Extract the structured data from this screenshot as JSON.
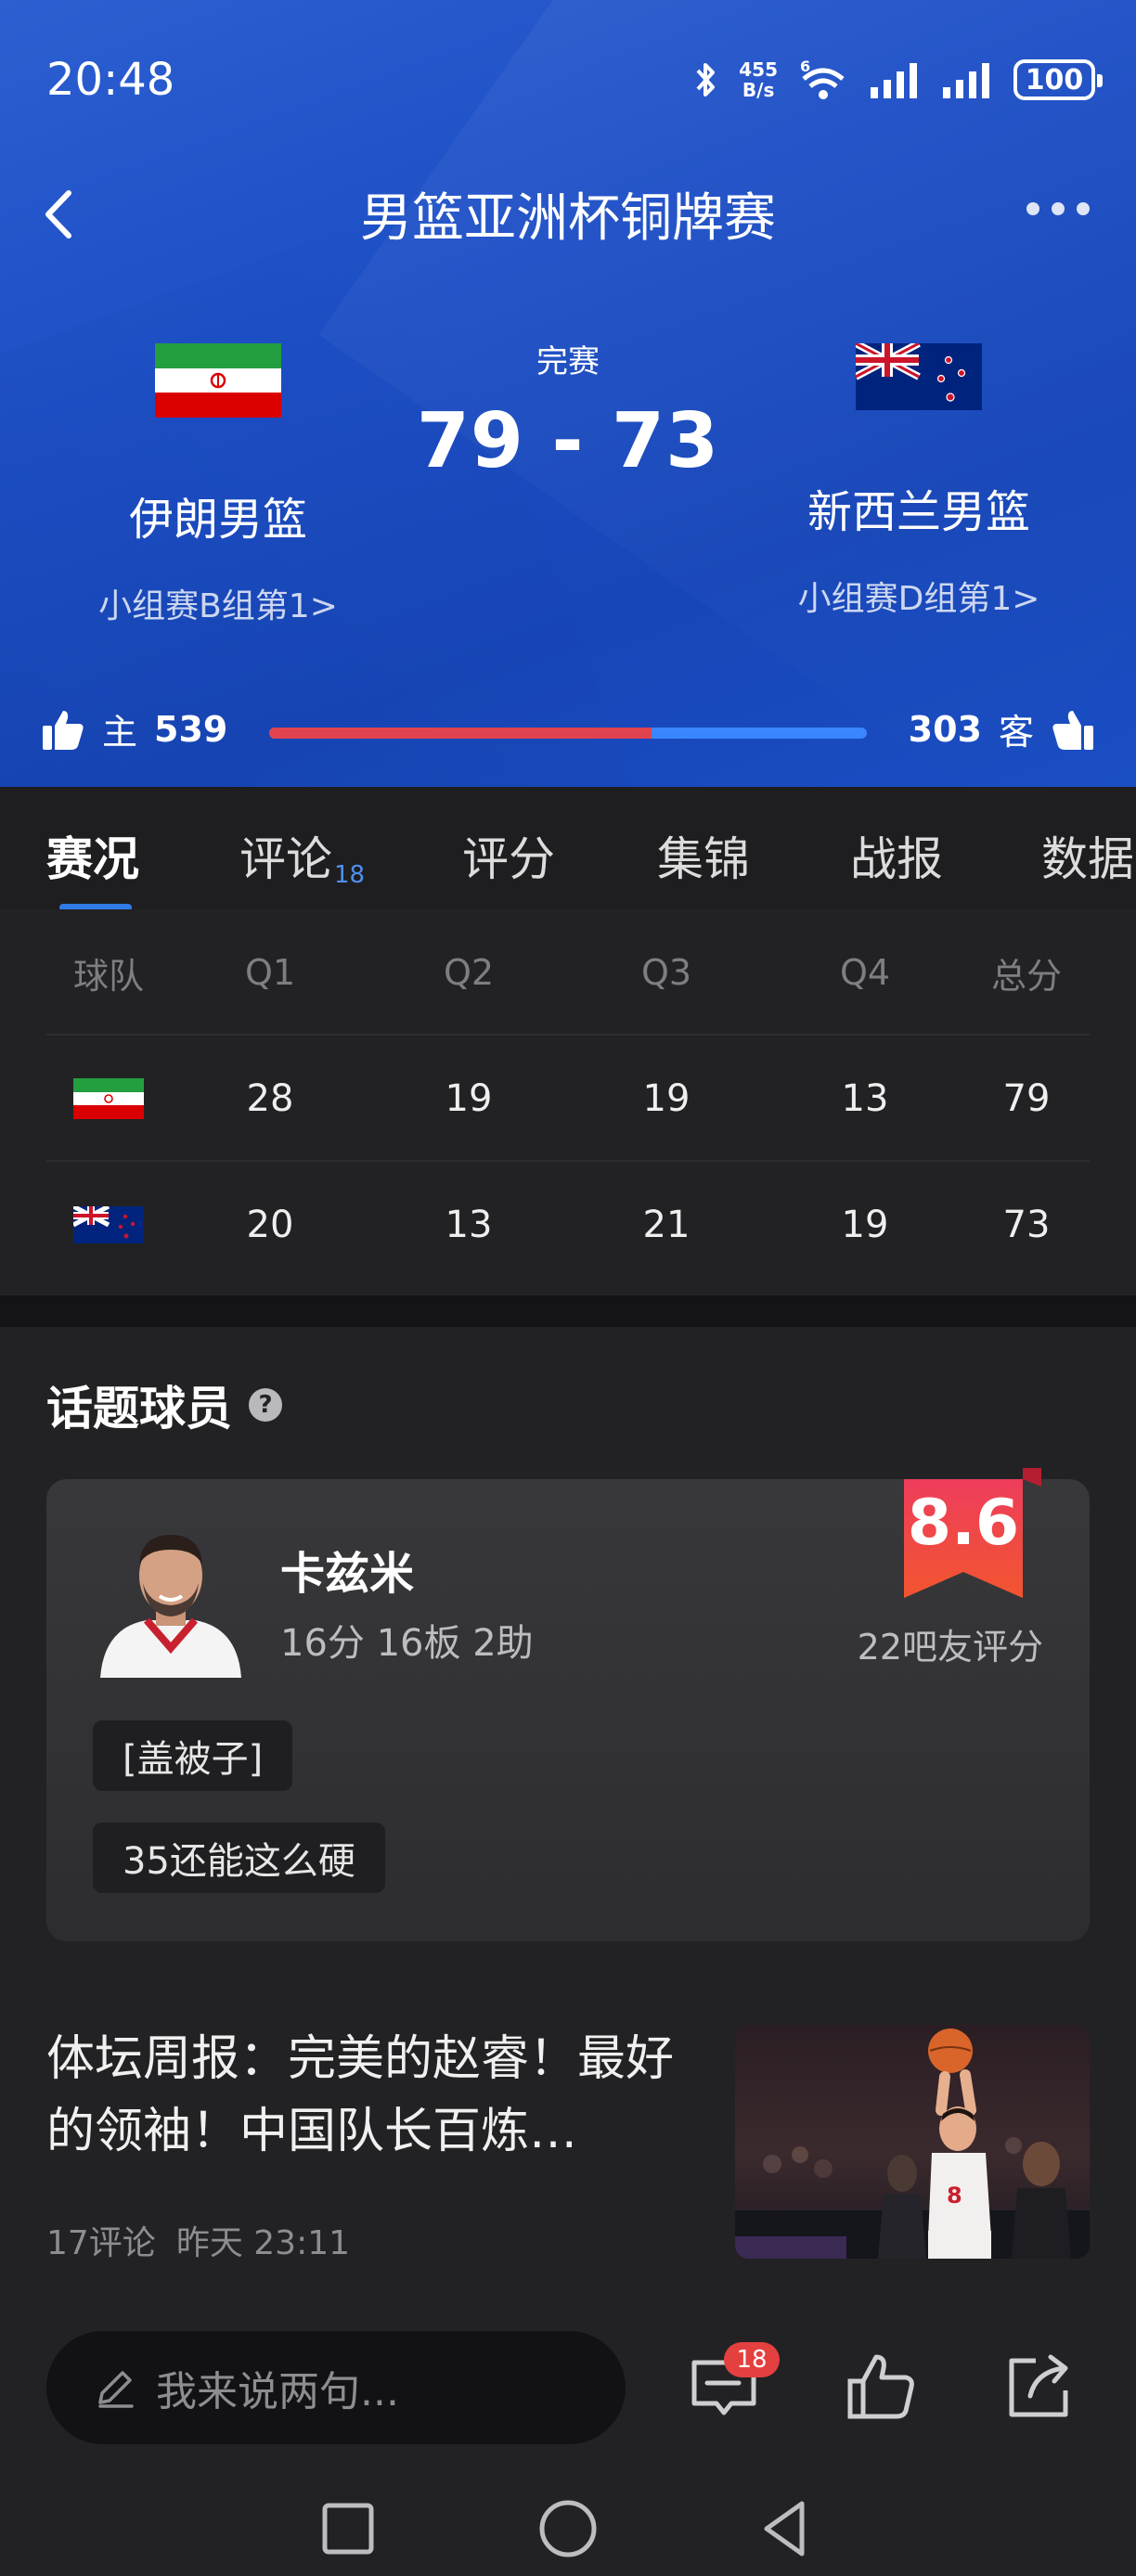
{
  "status_bar": {
    "time": "20:48",
    "net_speed_value": "455",
    "net_speed_unit": "B/s",
    "wifi_label": "6",
    "battery": "100"
  },
  "header": {
    "title": "男篮亚洲杯铜牌赛",
    "match_status": "完赛",
    "score": "79 - 73",
    "home": {
      "name": "伊朗男篮",
      "group": "小组赛B组第1>",
      "flag": "iran-flag"
    },
    "away": {
      "name": "新西兰男篮",
      "group": "小组赛D组第1>",
      "flag": "new-zealand-flag"
    }
  },
  "likes": {
    "home_label": "主",
    "home_count": "539",
    "away_label": "客",
    "away_count": "303",
    "home_share": 0.64
  },
  "tabs": [
    {
      "label": "赛况",
      "active": true
    },
    {
      "label": "评论",
      "count": "18"
    },
    {
      "label": "评分"
    },
    {
      "label": "集锦"
    },
    {
      "label": "战报"
    },
    {
      "label": "数据"
    }
  ],
  "score_table": {
    "headers": [
      "球队",
      "Q1",
      "Q2",
      "Q3",
      "Q4",
      "总分"
    ],
    "rows": [
      {
        "team_flag": "iran-flag",
        "q": [
          "28",
          "19",
          "19",
          "13"
        ],
        "total": "79"
      },
      {
        "team_flag": "new-zealand-flag",
        "q": [
          "20",
          "13",
          "21",
          "19"
        ],
        "total": "73"
      }
    ]
  },
  "topic_players": {
    "title": "话题球员",
    "help": "?",
    "player": {
      "name": "卡兹米",
      "stats": "16分 16板 2助",
      "rating": "8.6",
      "rating_count": "22吧友评分"
    },
    "comments": [
      "[盖被子]",
      "35还能这么硬"
    ]
  },
  "news": {
    "title": "体坛周报：完美的赵睿！最好的领袖！中国队长百炼…",
    "comments": "17评论",
    "time": "昨天 23:11"
  },
  "bottom_bar": {
    "input_placeholder": "我来说两句...",
    "comment_badge": "18"
  },
  "colors": {
    "header_blue": "#1d4fc6",
    "home_like": "#e0434f",
    "away_like": "#3a86ff",
    "rating_badge": "#e8365a",
    "accent": "#2f7be8"
  }
}
